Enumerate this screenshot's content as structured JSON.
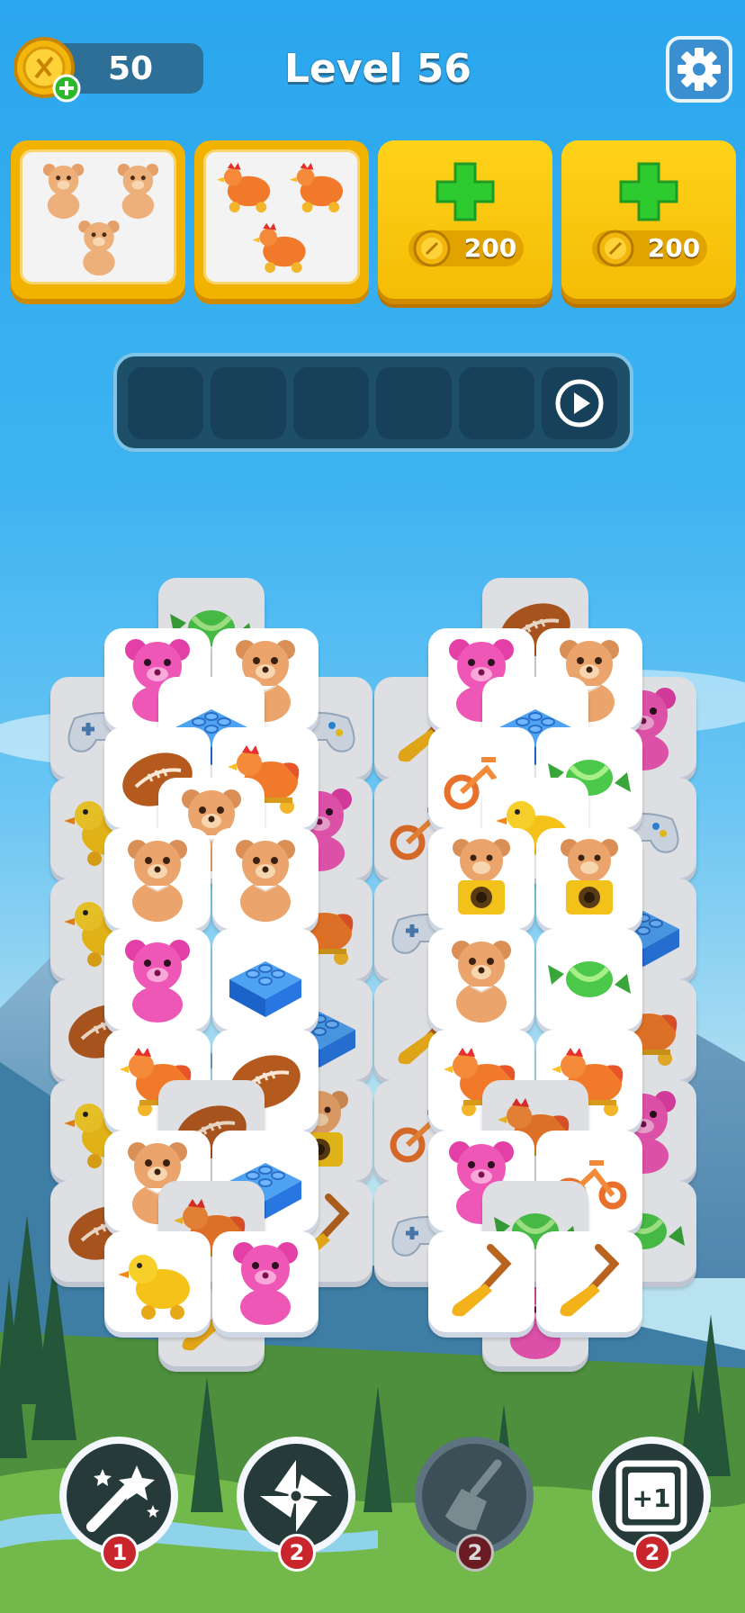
{
  "header": {
    "coins": "50",
    "level_title": "Level 56"
  },
  "goals": [
    {
      "item": "teddy-bear",
      "count": 3
    },
    {
      "item": "rooster-toy",
      "count": 3
    }
  ],
  "extra_slots": [
    {
      "price": "200"
    },
    {
      "price": "200"
    }
  ],
  "tray": {
    "slots": 6,
    "filled": 0
  },
  "boosters": [
    {
      "name": "magic-wand",
      "count": "1",
      "enabled": true
    },
    {
      "name": "pinwheel-shuffle",
      "count": "2",
      "enabled": true
    },
    {
      "name": "broom-clear",
      "count": "2",
      "enabled": false
    },
    {
      "name": "plus-one-slot",
      "count": "2",
      "enabled": true
    }
  ],
  "board_items": [
    "candy",
    "teddy-bear",
    "pink-bear",
    "lego-brick",
    "gamepad",
    "football",
    "rooster-toy",
    "duck-toy",
    "shovel",
    "tricycle",
    "camera-bear"
  ],
  "colors": {
    "gold": "#f4bc05",
    "tray": "#1e4f68",
    "badge": "#c8262c"
  }
}
